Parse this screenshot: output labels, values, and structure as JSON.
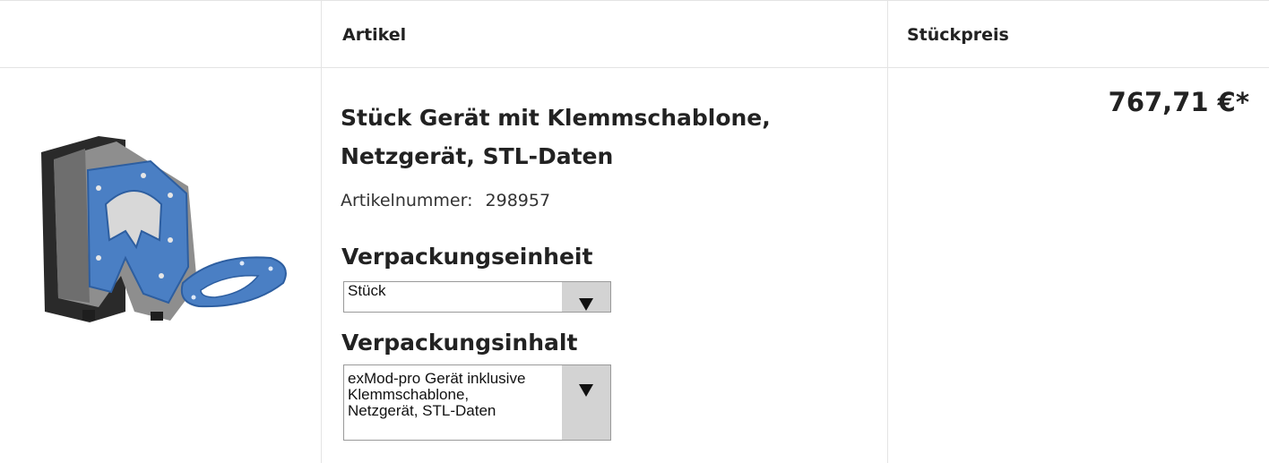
{
  "table": {
    "headers": {
      "article": "Artikel",
      "unit_price": "Stückpreis"
    }
  },
  "product": {
    "title": "Stück Gerät mit Klemmschablone, Netzgerät, STL-Daten",
    "article_number_label": "Artikelnummer:",
    "article_number": "298957",
    "price": "767,71 €*",
    "image_icon": "product-device-image"
  },
  "packaging_unit": {
    "label": "Verpackungseinheit",
    "selected": "Stück"
  },
  "packaging_content": {
    "label": "Verpackungsinhalt",
    "selected": "exMod-pro Gerät inklusive\nKlemmschablone,\nNetzgerät, STL-Daten"
  },
  "colors": {
    "accent_blue": "#4a7fc4",
    "border": "#e4e4e4",
    "select_button": "#d3d3d3"
  }
}
